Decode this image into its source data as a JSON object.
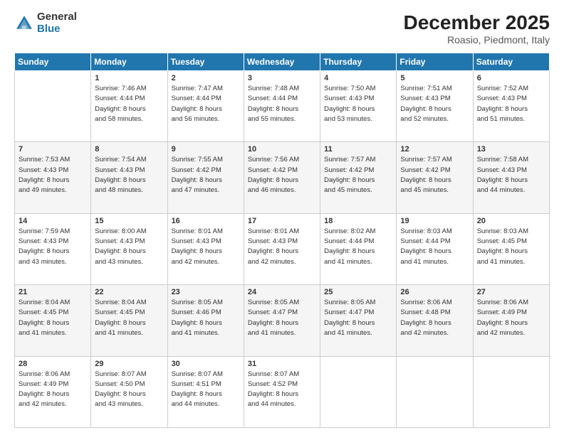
{
  "logo": {
    "general": "General",
    "blue": "Blue"
  },
  "header": {
    "month_year": "December 2025",
    "location": "Roasio, Piedmont, Italy"
  },
  "weekdays": [
    "Sunday",
    "Monday",
    "Tuesday",
    "Wednesday",
    "Thursday",
    "Friday",
    "Saturday"
  ],
  "weeks": [
    [
      {
        "day": "",
        "sunrise": "",
        "sunset": "",
        "daylight": ""
      },
      {
        "day": "1",
        "sunrise": "Sunrise: 7:46 AM",
        "sunset": "Sunset: 4:44 PM",
        "daylight": "Daylight: 8 hours and 58 minutes."
      },
      {
        "day": "2",
        "sunrise": "Sunrise: 7:47 AM",
        "sunset": "Sunset: 4:44 PM",
        "daylight": "Daylight: 8 hours and 56 minutes."
      },
      {
        "day": "3",
        "sunrise": "Sunrise: 7:48 AM",
        "sunset": "Sunset: 4:44 PM",
        "daylight": "Daylight: 8 hours and 55 minutes."
      },
      {
        "day": "4",
        "sunrise": "Sunrise: 7:50 AM",
        "sunset": "Sunset: 4:43 PM",
        "daylight": "Daylight: 8 hours and 53 minutes."
      },
      {
        "day": "5",
        "sunrise": "Sunrise: 7:51 AM",
        "sunset": "Sunset: 4:43 PM",
        "daylight": "Daylight: 8 hours and 52 minutes."
      },
      {
        "day": "6",
        "sunrise": "Sunrise: 7:52 AM",
        "sunset": "Sunset: 4:43 PM",
        "daylight": "Daylight: 8 hours and 51 minutes."
      }
    ],
    [
      {
        "day": "7",
        "sunrise": "Sunrise: 7:53 AM",
        "sunset": "Sunset: 4:43 PM",
        "daylight": "Daylight: 8 hours and 49 minutes."
      },
      {
        "day": "8",
        "sunrise": "Sunrise: 7:54 AM",
        "sunset": "Sunset: 4:43 PM",
        "daylight": "Daylight: 8 hours and 48 minutes."
      },
      {
        "day": "9",
        "sunrise": "Sunrise: 7:55 AM",
        "sunset": "Sunset: 4:42 PM",
        "daylight": "Daylight: 8 hours and 47 minutes."
      },
      {
        "day": "10",
        "sunrise": "Sunrise: 7:56 AM",
        "sunset": "Sunset: 4:42 PM",
        "daylight": "Daylight: 8 hours and 46 minutes."
      },
      {
        "day": "11",
        "sunrise": "Sunrise: 7:57 AM",
        "sunset": "Sunset: 4:42 PM",
        "daylight": "Daylight: 8 hours and 45 minutes."
      },
      {
        "day": "12",
        "sunrise": "Sunrise: 7:57 AM",
        "sunset": "Sunset: 4:42 PM",
        "daylight": "Daylight: 8 hours and 45 minutes."
      },
      {
        "day": "13",
        "sunrise": "Sunrise: 7:58 AM",
        "sunset": "Sunset: 4:43 PM",
        "daylight": "Daylight: 8 hours and 44 minutes."
      }
    ],
    [
      {
        "day": "14",
        "sunrise": "Sunrise: 7:59 AM",
        "sunset": "Sunset: 4:43 PM",
        "daylight": "Daylight: 8 hours and 43 minutes."
      },
      {
        "day": "15",
        "sunrise": "Sunrise: 8:00 AM",
        "sunset": "Sunset: 4:43 PM",
        "daylight": "Daylight: 8 hours and 43 minutes."
      },
      {
        "day": "16",
        "sunrise": "Sunrise: 8:01 AM",
        "sunset": "Sunset: 4:43 PM",
        "daylight": "Daylight: 8 hours and 42 minutes."
      },
      {
        "day": "17",
        "sunrise": "Sunrise: 8:01 AM",
        "sunset": "Sunset: 4:43 PM",
        "daylight": "Daylight: 8 hours and 42 minutes."
      },
      {
        "day": "18",
        "sunrise": "Sunrise: 8:02 AM",
        "sunset": "Sunset: 4:44 PM",
        "daylight": "Daylight: 8 hours and 41 minutes."
      },
      {
        "day": "19",
        "sunrise": "Sunrise: 8:03 AM",
        "sunset": "Sunset: 4:44 PM",
        "daylight": "Daylight: 8 hours and 41 minutes."
      },
      {
        "day": "20",
        "sunrise": "Sunrise: 8:03 AM",
        "sunset": "Sunset: 4:45 PM",
        "daylight": "Daylight: 8 hours and 41 minutes."
      }
    ],
    [
      {
        "day": "21",
        "sunrise": "Sunrise: 8:04 AM",
        "sunset": "Sunset: 4:45 PM",
        "daylight": "Daylight: 8 hours and 41 minutes."
      },
      {
        "day": "22",
        "sunrise": "Sunrise: 8:04 AM",
        "sunset": "Sunset: 4:45 PM",
        "daylight": "Daylight: 8 hours and 41 minutes."
      },
      {
        "day": "23",
        "sunrise": "Sunrise: 8:05 AM",
        "sunset": "Sunset: 4:46 PM",
        "daylight": "Daylight: 8 hours and 41 minutes."
      },
      {
        "day": "24",
        "sunrise": "Sunrise: 8:05 AM",
        "sunset": "Sunset: 4:47 PM",
        "daylight": "Daylight: 8 hours and 41 minutes."
      },
      {
        "day": "25",
        "sunrise": "Sunrise: 8:05 AM",
        "sunset": "Sunset: 4:47 PM",
        "daylight": "Daylight: 8 hours and 41 minutes."
      },
      {
        "day": "26",
        "sunrise": "Sunrise: 8:06 AM",
        "sunset": "Sunset: 4:48 PM",
        "daylight": "Daylight: 8 hours and 42 minutes."
      },
      {
        "day": "27",
        "sunrise": "Sunrise: 8:06 AM",
        "sunset": "Sunset: 4:49 PM",
        "daylight": "Daylight: 8 hours and 42 minutes."
      }
    ],
    [
      {
        "day": "28",
        "sunrise": "Sunrise: 8:06 AM",
        "sunset": "Sunset: 4:49 PM",
        "daylight": "Daylight: 8 hours and 42 minutes."
      },
      {
        "day": "29",
        "sunrise": "Sunrise: 8:07 AM",
        "sunset": "Sunset: 4:50 PM",
        "daylight": "Daylight: 8 hours and 43 minutes."
      },
      {
        "day": "30",
        "sunrise": "Sunrise: 8:07 AM",
        "sunset": "Sunset: 4:51 PM",
        "daylight": "Daylight: 8 hours and 44 minutes."
      },
      {
        "day": "31",
        "sunrise": "Sunrise: 8:07 AM",
        "sunset": "Sunset: 4:52 PM",
        "daylight": "Daylight: 8 hours and 44 minutes."
      },
      {
        "day": "",
        "sunrise": "",
        "sunset": "",
        "daylight": ""
      },
      {
        "day": "",
        "sunrise": "",
        "sunset": "",
        "daylight": ""
      },
      {
        "day": "",
        "sunrise": "",
        "sunset": "",
        "daylight": ""
      }
    ]
  ]
}
